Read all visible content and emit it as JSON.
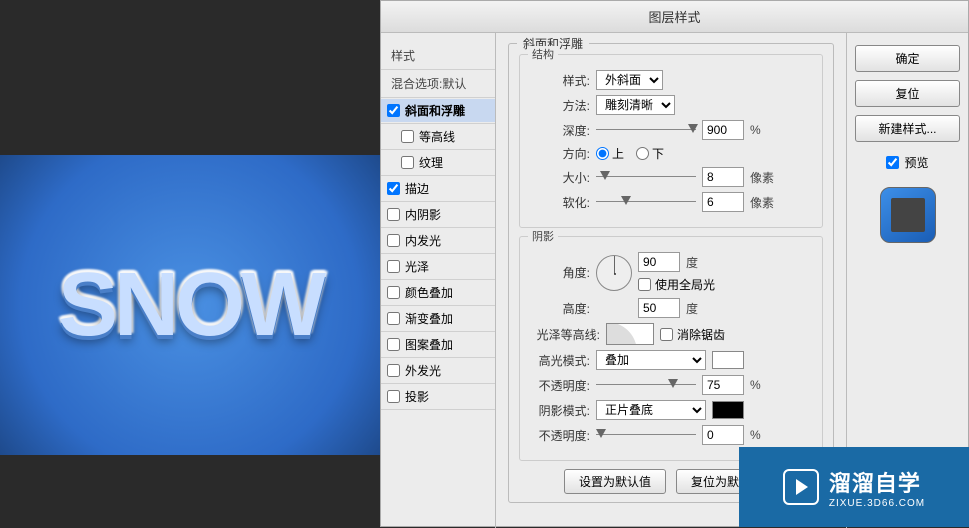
{
  "dialog": {
    "title": "图层样式",
    "list_header": "样式",
    "blend_header": "混合选项:默认",
    "effects": [
      {
        "label": "斜面和浮雕",
        "checked": true,
        "selected": true,
        "indent": false
      },
      {
        "label": "等高线",
        "checked": false,
        "selected": false,
        "indent": true
      },
      {
        "label": "纹理",
        "checked": false,
        "selected": false,
        "indent": true
      },
      {
        "label": "描边",
        "checked": true,
        "selected": false,
        "indent": false
      },
      {
        "label": "内阴影",
        "checked": false,
        "selected": false,
        "indent": false
      },
      {
        "label": "内发光",
        "checked": false,
        "selected": false,
        "indent": false
      },
      {
        "label": "光泽",
        "checked": false,
        "selected": false,
        "indent": false
      },
      {
        "label": "颜色叠加",
        "checked": false,
        "selected": false,
        "indent": false
      },
      {
        "label": "渐变叠加",
        "checked": false,
        "selected": false,
        "indent": false
      },
      {
        "label": "图案叠加",
        "checked": false,
        "selected": false,
        "indent": false
      },
      {
        "label": "外发光",
        "checked": false,
        "selected": false,
        "indent": false
      },
      {
        "label": "投影",
        "checked": false,
        "selected": false,
        "indent": false
      }
    ]
  },
  "bevel": {
    "panel_title": "斜面和浮雕",
    "struct_title": "结构",
    "style_label": "样式:",
    "style_value": "外斜面",
    "method_label": "方法:",
    "method_value": "雕刻清晰",
    "depth_label": "深度:",
    "depth_value": "900",
    "depth_unit": "%",
    "direction_label": "方向:",
    "direction_up": "上",
    "direction_down": "下",
    "size_label": "大小:",
    "size_value": "8",
    "size_unit": "像素",
    "soften_label": "软化:",
    "soften_value": "6",
    "soften_unit": "像素"
  },
  "shadow": {
    "section_title": "阴影",
    "angle_label": "角度:",
    "angle_value": "90",
    "angle_unit": "度",
    "global_light": "使用全局光",
    "altitude_label": "高度:",
    "altitude_value": "50",
    "altitude_unit": "度",
    "contour_label": "光泽等高线:",
    "antialias": "消除锯齿",
    "hi_mode_label": "高光模式:",
    "hi_mode_value": "叠加",
    "hi_opacity_label": "不透明度:",
    "hi_opacity_value": "75",
    "hi_opacity_unit": "%",
    "sh_mode_label": "阴影模式:",
    "sh_mode_value": "正片叠底",
    "sh_opacity_label": "不透明度:",
    "sh_opacity_value": "0",
    "sh_opacity_unit": "%"
  },
  "footer": {
    "make_default": "设置为默认值",
    "reset_default": "复位为默认值"
  },
  "right": {
    "ok": "确定",
    "reset": "复位",
    "new_style": "新建样式...",
    "preview": "预览"
  },
  "canvas": {
    "text": "SNOW"
  },
  "watermark": {
    "main": "溜溜自学",
    "sub": "ZIXUE.3D66.COM"
  }
}
